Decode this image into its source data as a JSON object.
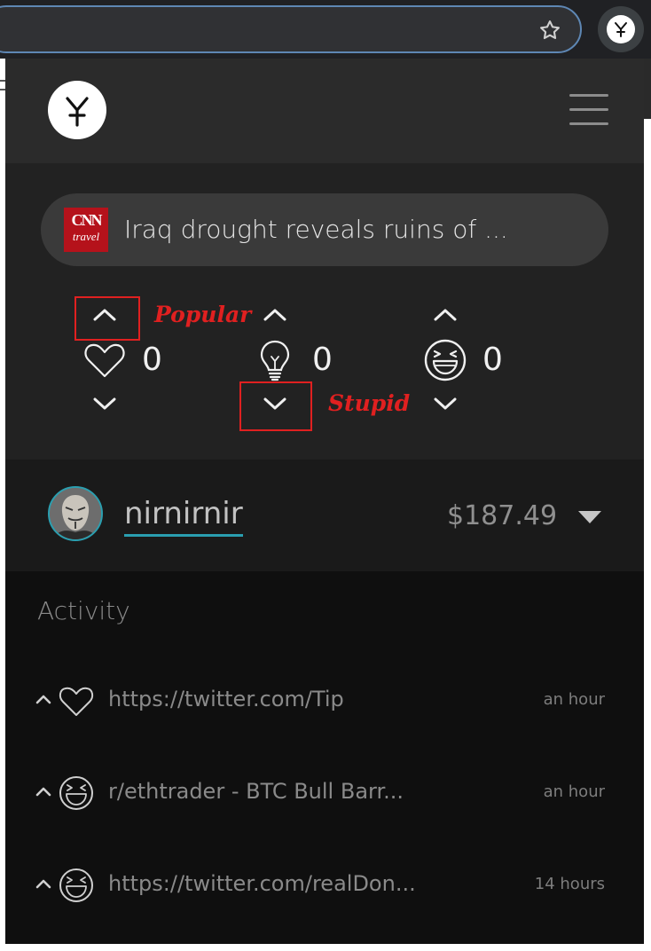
{
  "extension": {
    "icon": "yope-logo-icon"
  },
  "popup": {
    "header": {
      "logo_icon": "yope-logo-icon",
      "menu_icon": "hamburger-menu-icon"
    },
    "article": {
      "source_logo_line1": "CNN",
      "source_logo_line2": "travel",
      "title": "Iraq drought reveals ruins of ..."
    },
    "reactions": [
      {
        "name": "heart",
        "count": "0"
      },
      {
        "name": "lightbulb",
        "count": "0"
      },
      {
        "name": "laughing-face",
        "count": "0"
      }
    ],
    "annotations": {
      "popular": "Popular",
      "stupid": "Stupid"
    },
    "user": {
      "name": "nirnirnir",
      "balance": "$187.49"
    },
    "activity": {
      "title": "Activity",
      "items": [
        {
          "icon": "heart-icon",
          "text": "https://twitter.com/Tip",
          "time": "an hour"
        },
        {
          "icon": "laughing-face-icon",
          "text": "r/ethtrader - BTC Bull Barr...",
          "time": "an hour"
        },
        {
          "icon": "laughing-face-icon",
          "text": "https://twitter.com/realDon...",
          "time": "14 hours"
        }
      ]
    }
  },
  "colors": {
    "accent": "#2a9fb0",
    "annotation": "#e02020",
    "cnn_red": "#b5121b"
  }
}
